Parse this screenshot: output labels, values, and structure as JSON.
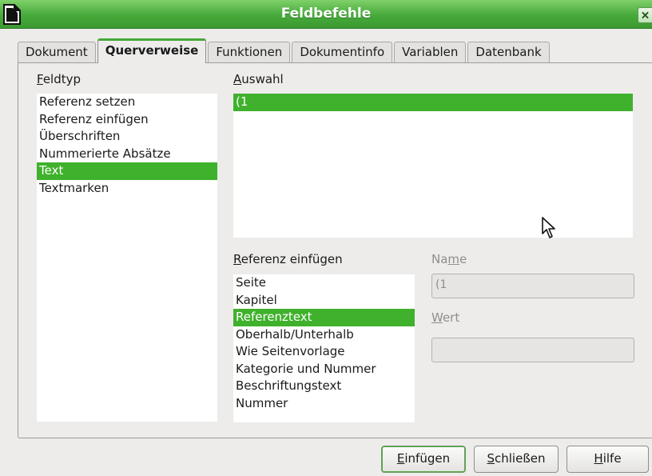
{
  "window": {
    "title": "Feldbefehle",
    "close_label": "✕"
  },
  "tabs": [
    {
      "label": "Dokument",
      "active": false
    },
    {
      "label": "Querverweise",
      "active": true
    },
    {
      "label": "Funktionen",
      "active": false
    },
    {
      "label": "Dokumentinfo",
      "active": false
    },
    {
      "label": "Variablen",
      "active": false
    },
    {
      "label": "Datenbank",
      "active": false
    }
  ],
  "feldtyp": {
    "label_first": "F",
    "label_rest": "eldtyp",
    "items": [
      "Referenz setzen",
      "Referenz einfügen",
      "Überschriften",
      "Nummerierte Absätze",
      "Text",
      "Textmarken"
    ],
    "selected": "Text"
  },
  "auswahl": {
    "label_first": "A",
    "label_rest": "uswahl",
    "items": [
      "(1"
    ],
    "selected": "(1"
  },
  "referenz": {
    "label_first": "R",
    "label_rest": "eferenz einfügen",
    "items": [
      "Seite",
      "Kapitel",
      "Referenztext",
      "Oberhalb/Unterhalb",
      "Wie Seitenvorlage",
      "Kategorie und Nummer",
      "Beschriftungstext",
      "Nummer"
    ],
    "selected": "Referenztext"
  },
  "name_field": {
    "label_pre": "Na",
    "label_u": "m",
    "label_post": "e",
    "value": "(1"
  },
  "wert_field": {
    "label_first": "W",
    "label_rest": "ert",
    "value": ""
  },
  "buttons": {
    "insert_first": "E",
    "insert_rest": "infügen",
    "close_first": "S",
    "close_rest": "chließen",
    "help_first": "H",
    "help_rest": "ilfe"
  },
  "colors": {
    "accent": "#3fb12c",
    "titlebar": "#46a93a"
  }
}
